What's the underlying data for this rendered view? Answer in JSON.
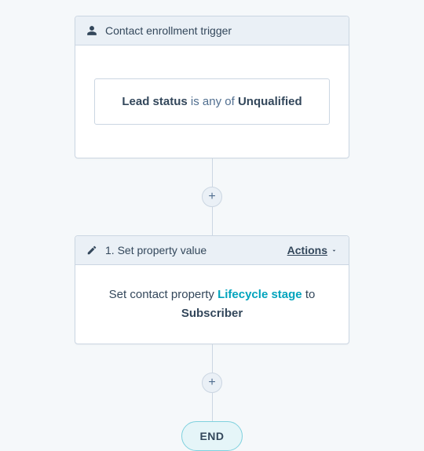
{
  "trigger": {
    "header": "Contact enrollment trigger",
    "criteria": {
      "property": "Lead status",
      "connector": "is any of",
      "value": "Unqualified"
    }
  },
  "step1": {
    "title": "1. Set property value",
    "actionsLabel": "Actions",
    "body": {
      "pre": "Set contact property ",
      "property": "Lifecycle stage",
      "to": " to",
      "value": "Subscriber"
    }
  },
  "addButton": "+",
  "endLabel": "END"
}
